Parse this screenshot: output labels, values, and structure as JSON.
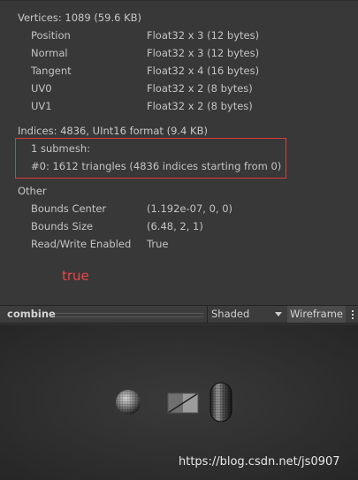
{
  "vertices": {
    "header": "Vertices: 1089 (59.6 KB)",
    "attributes": [
      {
        "name": "Position",
        "format": "Float32 x 3 (12 bytes)"
      },
      {
        "name": "Normal",
        "format": "Float32 x 3 (12 bytes)"
      },
      {
        "name": "Tangent",
        "format": "Float32 x 4 (16 bytes)"
      },
      {
        "name": "UV0",
        "format": "Float32 x 2 (8 bytes)"
      },
      {
        "name": "UV1",
        "format": "Float32 x 2 (8 bytes)"
      }
    ]
  },
  "indices": {
    "header": "Indices: 4836, UInt16 format (9.4 KB)",
    "submesh_count": "1 submesh:",
    "submesh_line": "#0: 1612 triangles (4836 indices starting from 0)"
  },
  "other": {
    "header": "Other",
    "rows": [
      {
        "name": "Bounds Center",
        "value": "(1.192e-07, 0, 0)"
      },
      {
        "name": "Bounds Size",
        "value": "(6.48, 2, 1)"
      },
      {
        "name": "Read/Write Enabled",
        "value": "True"
      }
    ]
  },
  "annotation": "true",
  "preview_toolbar": {
    "title": "combine",
    "shading_mode": "Shaded",
    "wireframe_label": "Wireframe"
  },
  "watermark": "https://blog.csdn.net/js0907",
  "colors": {
    "highlight": "#e03a3a",
    "annotation": "#e74646"
  },
  "icons": [
    "chevron-down-icon",
    "kebab-menu-icon"
  ]
}
